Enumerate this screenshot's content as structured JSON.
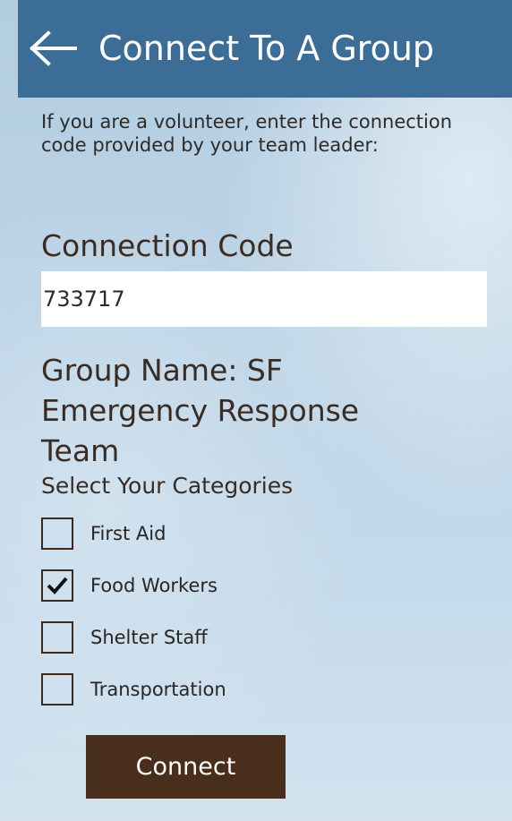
{
  "header": {
    "title": "Connect To A Group",
    "back_icon": "left-arrow-icon"
  },
  "instructions": "If you are a volunteer, enter the connection code provided by your team leader:",
  "connection_code": {
    "label": "Connection Code",
    "value": "733717"
  },
  "group_name": "Group Name: SF Emergency Response Team",
  "categories": {
    "label": "Select Your Categories",
    "items": [
      {
        "label": "First Aid",
        "checked": false
      },
      {
        "label": "Food Workers",
        "checked": true
      },
      {
        "label": "Shelter Staff",
        "checked": false
      },
      {
        "label": "Transportation",
        "checked": false
      }
    ]
  },
  "connect_button": {
    "label": "Connect"
  },
  "colors": {
    "header_bg": "#3c6d97",
    "button_bg": "#4a2e1c",
    "text_dark": "#3a2c22",
    "checkbox_border": "#3d2a1c"
  }
}
